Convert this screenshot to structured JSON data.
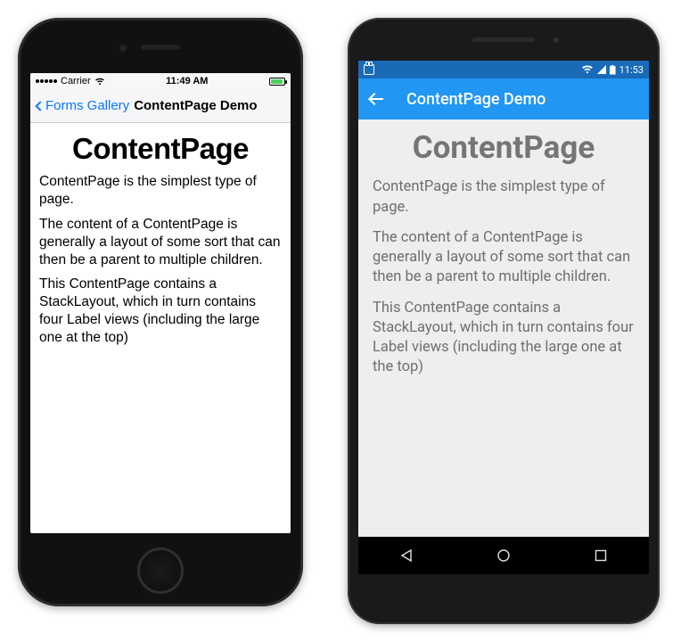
{
  "ios": {
    "status": {
      "carrier": "Carrier",
      "time": "11:49 AM"
    },
    "nav": {
      "back_label": "Forms Gallery",
      "title": "ContentPage Demo"
    },
    "content": {
      "heading": "ContentPage",
      "para1": "ContentPage is the simplest type of page.",
      "para2": "The content of a ContentPage is generally a layout of some sort that can then be a parent to multiple children.",
      "para3": "This ContentPage contains a StackLayout, which in turn contains four Label views (including the large one at the top)"
    }
  },
  "android": {
    "status": {
      "time": "11:53"
    },
    "appbar": {
      "title": "ContentPage Demo"
    },
    "content": {
      "heading": "ContentPage",
      "para1": "ContentPage is the simplest type of page.",
      "para2": "The content of a ContentPage is generally a layout of some sort that can then be a parent to multiple children.",
      "para3": "This ContentPage contains a StackLayout, which in turn contains four Label views (including the large one at the top)"
    }
  }
}
